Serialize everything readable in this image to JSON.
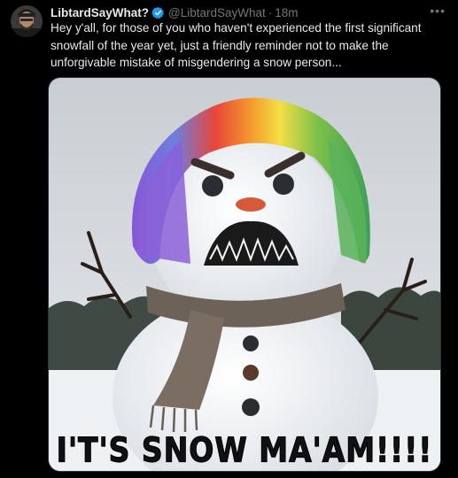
{
  "post": {
    "display_name": "LibtardSayWhat?",
    "handle": "@LibtardSayWhat",
    "separator": "·",
    "time": "18m",
    "more_icon": "more-horizontal-icon",
    "verified_icon": "verified-badge-icon",
    "text": "Hey y'all, for those of you who haven't experienced the first significant snowfall of the year yet, just a friendly reminder not to make the unforgivable  mistake of misgendering a snow person..."
  },
  "media": {
    "caption": "I'T'S SNOW MA'AM!!!!"
  },
  "colors": {
    "background": "#000000",
    "text": "#e7e9ea",
    "secondary_text": "#71767b",
    "verified": "#1d9bf0",
    "border": "#2f3336"
  }
}
